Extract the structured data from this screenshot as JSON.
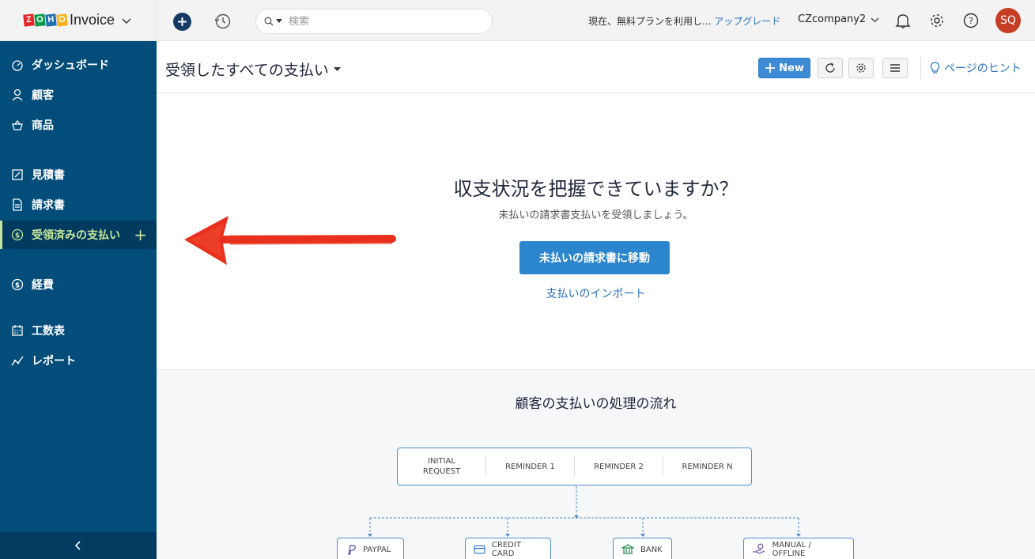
{
  "app": {
    "logo_letters": [
      "Z",
      "O",
      "H",
      "O"
    ],
    "logo_colors": [
      "#e42527",
      "#089949",
      "#226db4",
      "#f9b21d"
    ],
    "product": "Invoice"
  },
  "sidebar": {
    "items": [
      {
        "label": "ダッシュボード",
        "icon": "dashboard-icon"
      },
      {
        "label": "顧客",
        "icon": "user-icon"
      },
      {
        "label": "商品",
        "icon": "basket-icon"
      },
      {
        "label": "見積書",
        "icon": "estimate-icon"
      },
      {
        "label": "請求書",
        "icon": "invoice-icon"
      },
      {
        "label": "受領済みの支払い",
        "icon": "payment-icon",
        "active": true
      },
      {
        "label": "経費",
        "icon": "expense-icon"
      },
      {
        "label": "工数表",
        "icon": "timesheet-icon"
      },
      {
        "label": "レポート",
        "icon": "report-icon"
      }
    ],
    "plus_label": "+",
    "collapse_label": "‹"
  },
  "topbar": {
    "search_placeholder": "検索",
    "plan_text": "現在、無料プランを利用し...",
    "upgrade_label": "アップグレード",
    "company": "CZcompany2",
    "avatar_initials": "SQ"
  },
  "header": {
    "title": "受領したすべての支払い",
    "new_label": "New",
    "hint_label": "ページのヒント"
  },
  "empty_state": {
    "heading": "収支状況を把握できていますか？",
    "subtext": "未払いの請求書支払いを受領しましょう。",
    "cta_label": "未払いの請求書に移動",
    "import_label": "支払いのインポート"
  },
  "flow": {
    "title": "顧客の支払いの処理の流れ",
    "steps": [
      "INITIAL\nREQUEST",
      "REMINDER 1",
      "REMINDER 2",
      "REMINDER N"
    ],
    "methods": [
      "PAYPAL",
      "CREDIT CARD",
      "BANK",
      "MANUAL / OFFLINE"
    ]
  },
  "colors": {
    "sidebar": "#034d7a",
    "active_text": "#c8e49b",
    "accent": "#2b86cd",
    "link": "#2a73c1",
    "annotation_arrow": "#e8301c"
  }
}
